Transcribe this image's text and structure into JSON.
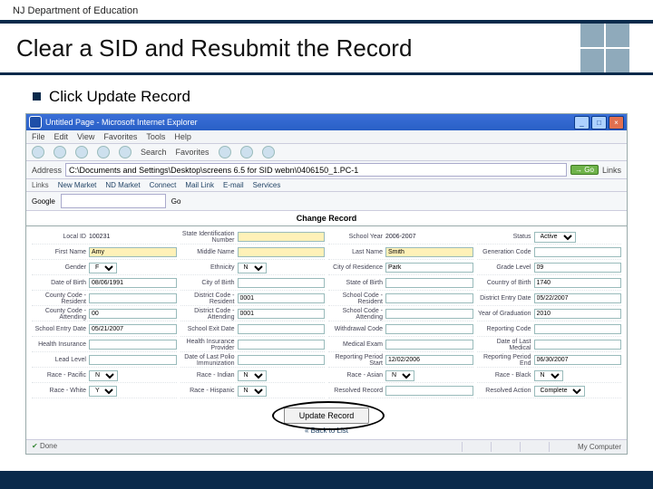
{
  "header": {
    "dept": "NJ Department of Education",
    "title": "Clear a SID and Resubmit the Record",
    "bullet": "Click Update Record"
  },
  "ie": {
    "title": "Untitled Page - Microsoft Internet Explorer",
    "menu": [
      "File",
      "Edit",
      "View",
      "Favorites",
      "Tools",
      "Help"
    ],
    "toolbar": {
      "search": "Search",
      "favorites": "Favorites"
    },
    "address": {
      "label": "Address",
      "value": "C:\\Documents and Settings\\Desktop\\screens 6.5 for SID webn\\0406150_1.PC-1",
      "go": "→ Go",
      "links": "Links"
    },
    "linksbar": {
      "label": "Links",
      "items": [
        "New Market",
        "ND Market",
        "Connect",
        "Mail Link",
        "E-mail",
        "Services"
      ]
    },
    "google": {
      "label": "Google",
      "go": "Go"
    },
    "status": {
      "left": "Done",
      "right": "My Computer"
    }
  },
  "form": {
    "title": "Change Record",
    "update_btn": "Update Record",
    "back_link": "« Back to List",
    "fields": [
      {
        "label": "Local ID",
        "value": "100231"
      },
      {
        "label": "State Identification Number",
        "value": ""
      },
      {
        "label": "School Year",
        "value": "2006-2007"
      },
      {
        "label": "Status",
        "value": "Active"
      },
      {
        "label": "First Name",
        "value": "Amy"
      },
      {
        "label": "Middle Name",
        "value": ""
      },
      {
        "label": "Last Name",
        "value": "Smith"
      },
      {
        "label": "Generation Code",
        "value": ""
      },
      {
        "label": "Gender",
        "value": "F"
      },
      {
        "label": "Ethnicity",
        "value": "N"
      },
      {
        "label": "City of Residence",
        "value": "Park"
      },
      {
        "label": "Grade Level",
        "value": "09"
      },
      {
        "label": "Date of Birth",
        "value": "08/06/1991"
      },
      {
        "label": "City of Birth",
        "value": ""
      },
      {
        "label": "State of Birth",
        "value": ""
      },
      {
        "label": "Country of Birth",
        "value": "1740"
      },
      {
        "label": "County Code - Resident",
        "value": ""
      },
      {
        "label": "District Code - Resident",
        "value": "0001"
      },
      {
        "label": "School Code - Resident",
        "value": ""
      },
      {
        "label": "District Entry Date",
        "value": "05/22/2007"
      },
      {
        "label": "County Code - Attending",
        "value": "00"
      },
      {
        "label": "District Code - Attending",
        "value": "0001"
      },
      {
        "label": "School Code - Attending",
        "value": ""
      },
      {
        "label": "Year of Graduation",
        "value": "2010"
      },
      {
        "label": "School Entry Date",
        "value": "05/21/2007"
      },
      {
        "label": "School Exit Date",
        "value": ""
      },
      {
        "label": "Withdrawal Code",
        "value": ""
      },
      {
        "label": "Reporting Code",
        "value": ""
      },
      {
        "label": "Health Insurance",
        "value": ""
      },
      {
        "label": "Health Insurance Provider",
        "value": ""
      },
      {
        "label": "Medical Exam",
        "value": ""
      },
      {
        "label": "Date of Last Medical",
        "value": ""
      },
      {
        "label": "Lead Level",
        "value": ""
      },
      {
        "label": "Date of Last Polio Immunization",
        "value": ""
      },
      {
        "label": "Reporting Period Start",
        "value": "12/02/2006"
      },
      {
        "label": "Reporting Period End",
        "value": "06/30/2007"
      },
      {
        "label": "Race - Pacific",
        "value": "N"
      },
      {
        "label": "Race - Indian",
        "value": "N"
      },
      {
        "label": "Race - Asian",
        "value": "N"
      },
      {
        "label": "Race - Black",
        "value": "N"
      },
      {
        "label": "Race - White",
        "value": "Y"
      },
      {
        "label": "Race - Hispanic",
        "value": "N"
      },
      {
        "label": "Resolved Record",
        "value": ""
      },
      {
        "label": "Resolved Action",
        "value": "Complete"
      }
    ]
  }
}
